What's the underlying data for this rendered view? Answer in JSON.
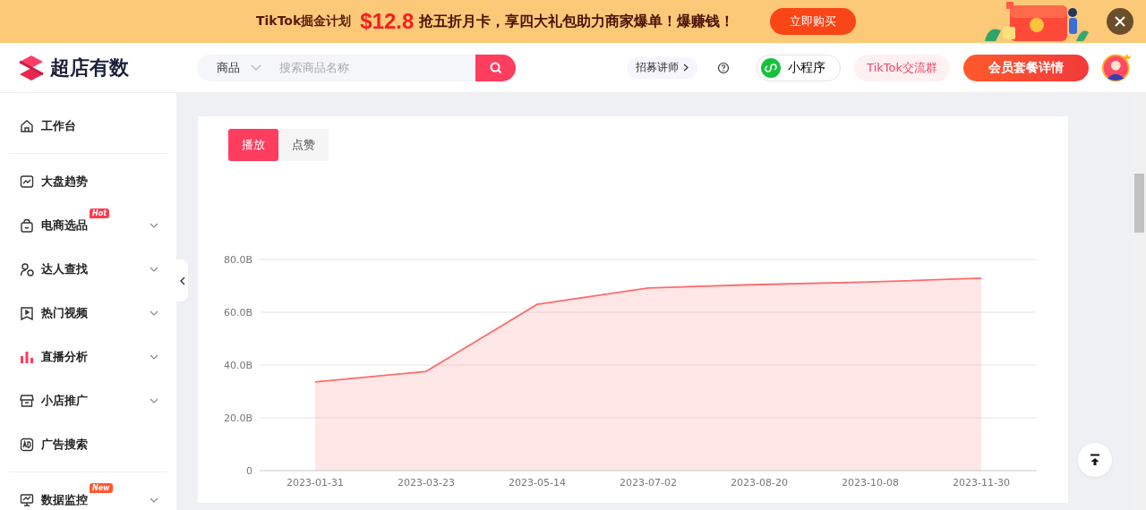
{
  "banner": {
    "title": "TikTok掘金计划",
    "price": "$12.8",
    "slogan": "抢五折月卡，享四大礼包助力商家爆单！爆赚钱！",
    "button": "立即购买"
  },
  "header": {
    "logo": "超店有数",
    "search": {
      "category": "商品",
      "placeholder": "搜索商品名称"
    },
    "recruit": "招募讲师",
    "mini_program": "小程序",
    "group": "TikTok交流群",
    "membership": "会员套餐详情"
  },
  "sidebar": {
    "items": [
      {
        "label": "工作台",
        "expandable": false
      },
      {
        "label": "大盘趋势",
        "expandable": false
      },
      {
        "label": "电商选品",
        "expandable": true,
        "badge": "Hot",
        "color": "#ff3b4e"
      },
      {
        "label": "达人查找",
        "expandable": true
      },
      {
        "label": "热门视频",
        "expandable": true
      },
      {
        "label": "直播分析",
        "expandable": true
      },
      {
        "label": "小店推广",
        "expandable": true
      },
      {
        "label": "广告搜索",
        "expandable": false
      },
      {
        "label": "数据监控",
        "expandable": true,
        "badge": "New",
        "color": "#ff5a2c"
      }
    ]
  },
  "tabs": [
    {
      "label": "播放",
      "selected": true
    },
    {
      "label": "点赞",
      "selected": false
    }
  ],
  "chart_data": {
    "type": "area",
    "grid": true,
    "categories": [
      "2023-01-31",
      "2023-03-23",
      "2023-05-14",
      "2023-07-02",
      "2023-08-20",
      "2023-10-08",
      "2023-11-30"
    ],
    "series": [
      {
        "color": "#ff6b6b",
        "values": [
          33.6,
          37.6,
          63,
          69.2,
          70.5,
          71.5,
          72.9
        ]
      }
    ],
    "ylim": [
      0,
      80
    ],
    "yticks": [
      {
        "value": 0,
        "label": "0"
      },
      {
        "value": 20,
        "label": "20.0B"
      },
      {
        "value": 40,
        "label": "40.0B"
      },
      {
        "value": 60,
        "label": "60.0B"
      },
      {
        "value": 80,
        "label": "80.0B"
      }
    ]
  }
}
